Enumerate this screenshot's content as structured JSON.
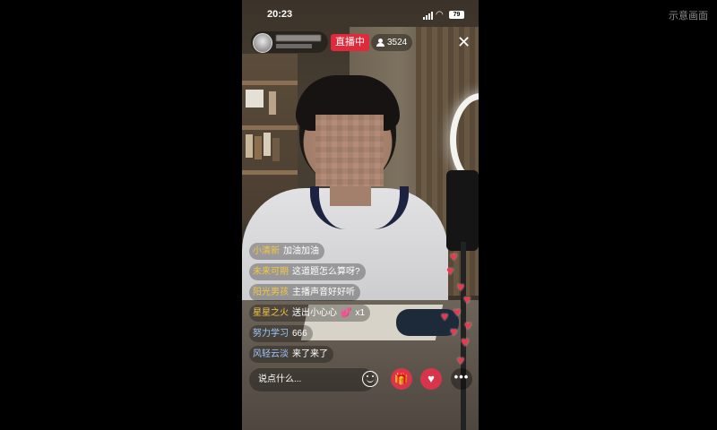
{
  "watermark": "示意画面",
  "status_bar": {
    "time": "20:23",
    "battery": "79"
  },
  "live": {
    "badge": "直播中",
    "viewers": "3524"
  },
  "comments": [
    {
      "name": "小清新",
      "text": "加油加油",
      "color": "yellow"
    },
    {
      "name": "未来可期",
      "text": "这道题怎么算呀?",
      "color": "yellow"
    },
    {
      "name": "阳光男孩",
      "text": "主播声音好好听",
      "color": "yellow"
    },
    {
      "name": "星星之火",
      "text": "送出小心心",
      "count": "x1",
      "color": "yellow"
    },
    {
      "name": "努力学习",
      "text": "666",
      "color": "blue"
    },
    {
      "name": "风轻云淡",
      "text": "来了来了",
      "color": "blue"
    }
  ],
  "input_placeholder": "说点什么...",
  "icons": {
    "close": "close-icon",
    "viewers": "user-icon",
    "emoji": "emoji-icon",
    "gift": "gift-icon",
    "like": "heart-icon",
    "more": "more-icon"
  },
  "colors": {
    "live_red": "#e0293a",
    "heart_red": "#e8394f",
    "name_yellow": "#f5c542",
    "name_blue": "#9cc7ff"
  }
}
